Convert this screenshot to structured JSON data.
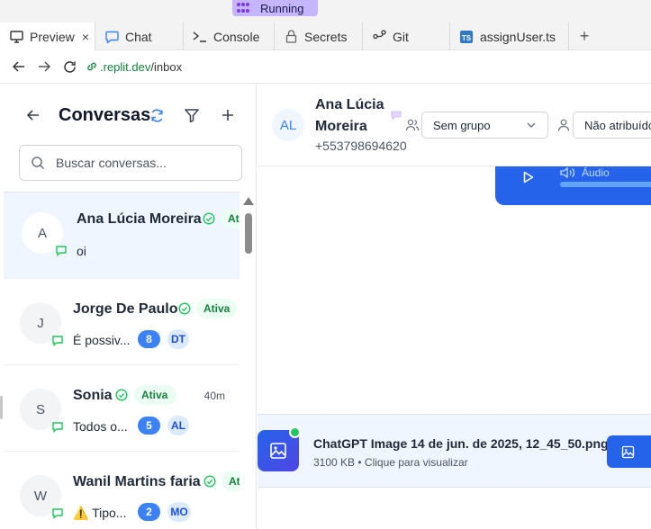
{
  "running": {
    "label": "Running"
  },
  "tabs": [
    {
      "label": "Preview",
      "icon": "monitor-icon",
      "active": true,
      "close": "×"
    },
    {
      "label": "Chat",
      "icon": "chat-icon"
    },
    {
      "label": "Console",
      "icon": "terminal-icon"
    },
    {
      "label": "Secrets",
      "icon": "lock-icon"
    },
    {
      "label": "Git",
      "icon": "git-icon"
    },
    {
      "label": "assignUser.ts",
      "icon": "typescript-file-icon"
    }
  ],
  "tab_add": "+",
  "address": {
    "domain": ".replit.dev",
    "path": "/inbox"
  },
  "sidebar": {
    "title": "Conversas",
    "search": {
      "placeholder": "Buscar conversas...",
      "value": ""
    },
    "conversations": [
      {
        "initial": "A",
        "name": "Ana Lúcia Moreira",
        "status": "Ativa",
        "preview": "oi",
        "count": "",
        "agent": "",
        "time": ""
      },
      {
        "initial": "J",
        "name": "Jorge De Paulo",
        "status": "Ativa",
        "preview": "É possiv...",
        "count": "8",
        "agent": "DT",
        "time": ""
      },
      {
        "initial": "S",
        "name": "Sonia",
        "status": "Ativa",
        "preview": "Todos o...",
        "count": "5",
        "agent": "AL",
        "time": "40m"
      },
      {
        "initial": "W",
        "name": "Wanil Martins faria",
        "status": "Ativa",
        "preview": "⚠️ Tipo...",
        "count": "2",
        "agent": "MO",
        "time": ""
      }
    ]
  },
  "chat": {
    "avatar_initials": "AL",
    "contact_name": "Ana Lúcia Moreira",
    "phone": "+553798694620",
    "group_select": "Sem grupo",
    "assignee_select": "Não atribuído",
    "audio_label": "Áudio",
    "attachment": {
      "name": "ChatGPT Image 14 de jun. de 2025, 12_45_50.png",
      "meta": "3100 KB • Clique para visualizar"
    }
  },
  "colors": {
    "accent": "#2563eb",
    "status_green": "#15803d",
    "running": "#c4b5fd"
  }
}
